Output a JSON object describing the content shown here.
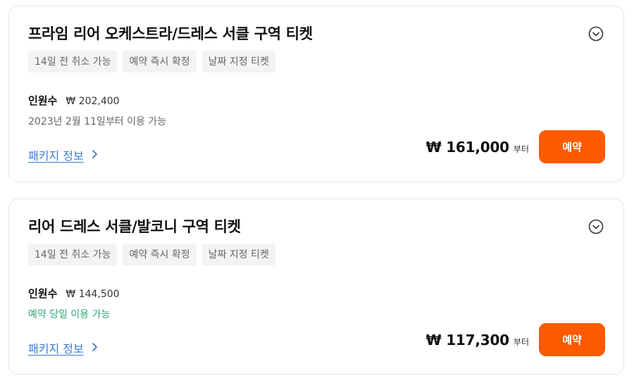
{
  "products": [
    {
      "title": "프라임 리어 오케스트라/드레스 서클 구역 티켓",
      "tags": [
        "14일 전 취소 가능",
        "예약 즉시 확정",
        "날짜 지정 티켓"
      ],
      "pax_label": "인원수",
      "pax_price": "₩ 202,400",
      "availability": "2023년 2월 11일부터 이용 가능",
      "availability_color": "#666666",
      "package_link": "패키지 정보",
      "price": "₩ 161,000",
      "price_suffix": "부터",
      "reserve_label": "예약",
      "expand_icon": "chevron-down-circle-icon",
      "link_icon": "chevron-right-icon"
    },
    {
      "title": "리어 드레스 서클/발코니 구역 티켓",
      "tags": [
        "14일 전 취소 가능",
        "예약 즉시 확정",
        "날짜 지정 티켓"
      ],
      "pax_label": "인원수",
      "pax_price": "₩ 144,500",
      "availability": "예약 당일 이용 가능",
      "availability_color": "#2ea873",
      "package_link": "패키지 정보",
      "price": "₩ 117,300",
      "price_suffix": "부터",
      "reserve_label": "예약",
      "expand_icon": "chevron-down-circle-icon",
      "link_icon": "chevron-right-icon"
    }
  ],
  "colors": {
    "accent": "#ff5a00",
    "link": "#3a7bd5",
    "tag_bg": "#f3f3f3"
  }
}
